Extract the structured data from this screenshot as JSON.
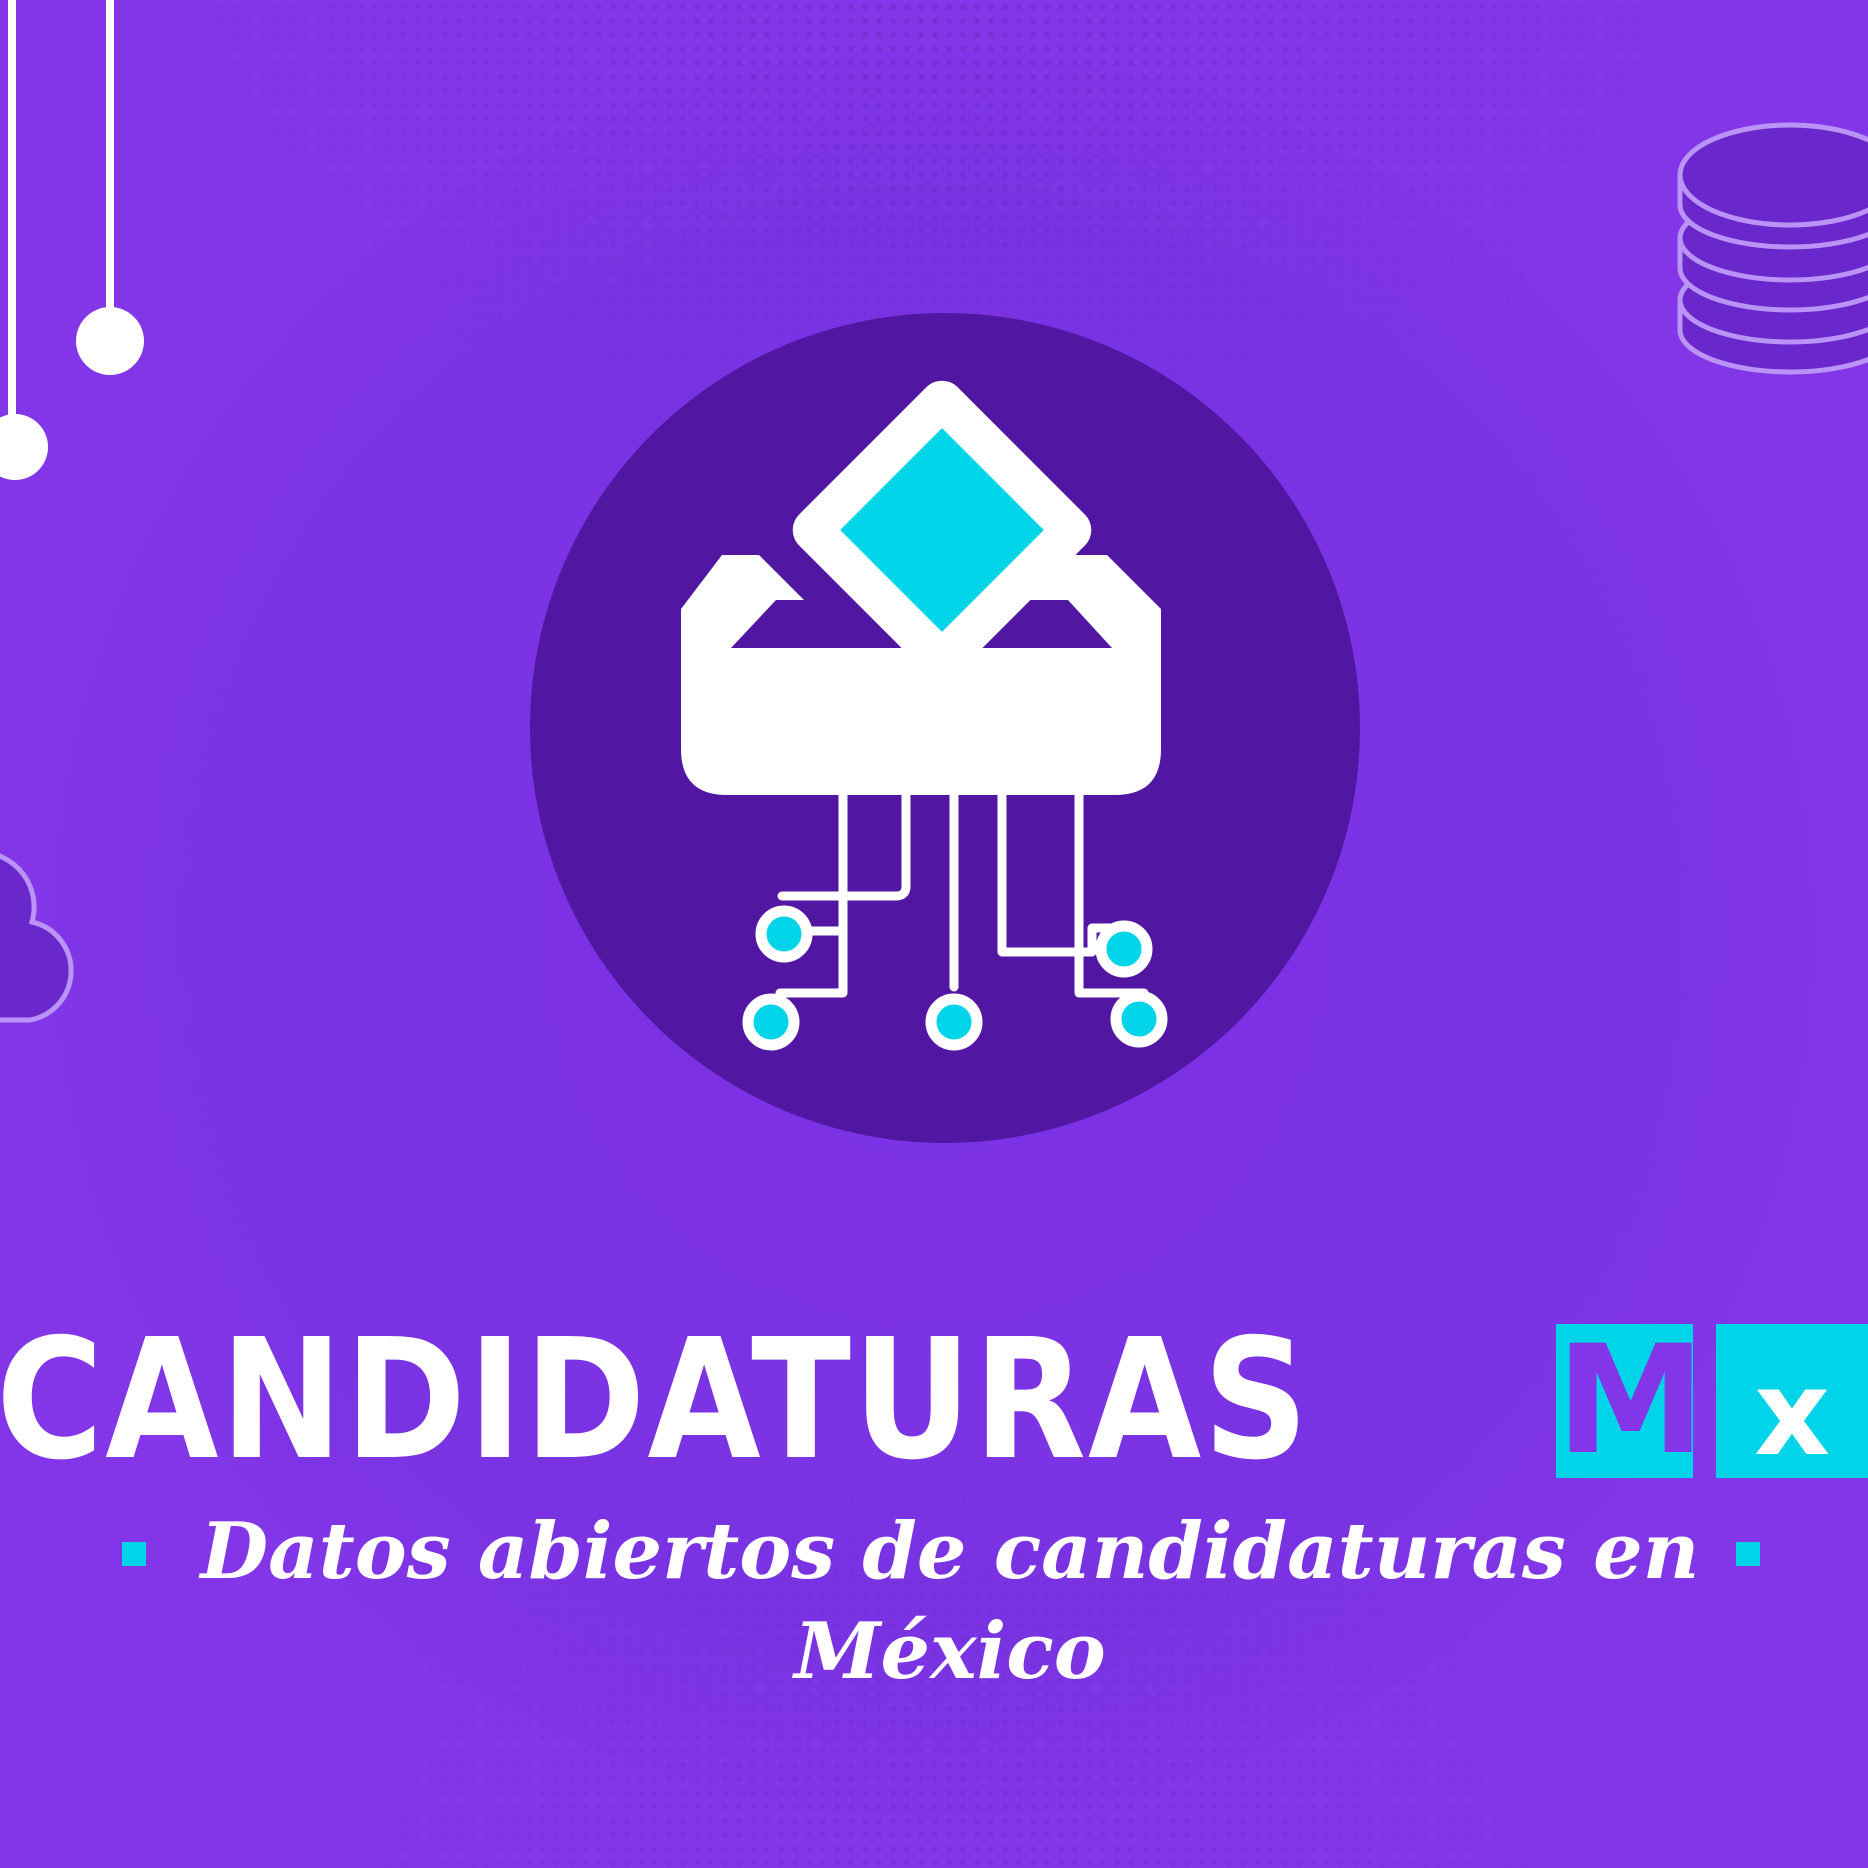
{
  "colors": {
    "background": "#8236e8",
    "emblem_circle": "#5117a3",
    "accent_cyan": "#00d4e8",
    "white": "#ffffff",
    "decor_line": "#b993f5"
  },
  "brand": {
    "name_main": "CANDIDATURAS",
    "name_suffix_m": "M",
    "name_suffix_x": "x",
    "tagline": "Datos abiertos de candidaturas en México"
  },
  "icons": {
    "emblem": "ballot-box-circuit-icon",
    "top_left": "hanging-pendants-icon",
    "top_right": "database-icon",
    "left": "cloud-icon"
  }
}
